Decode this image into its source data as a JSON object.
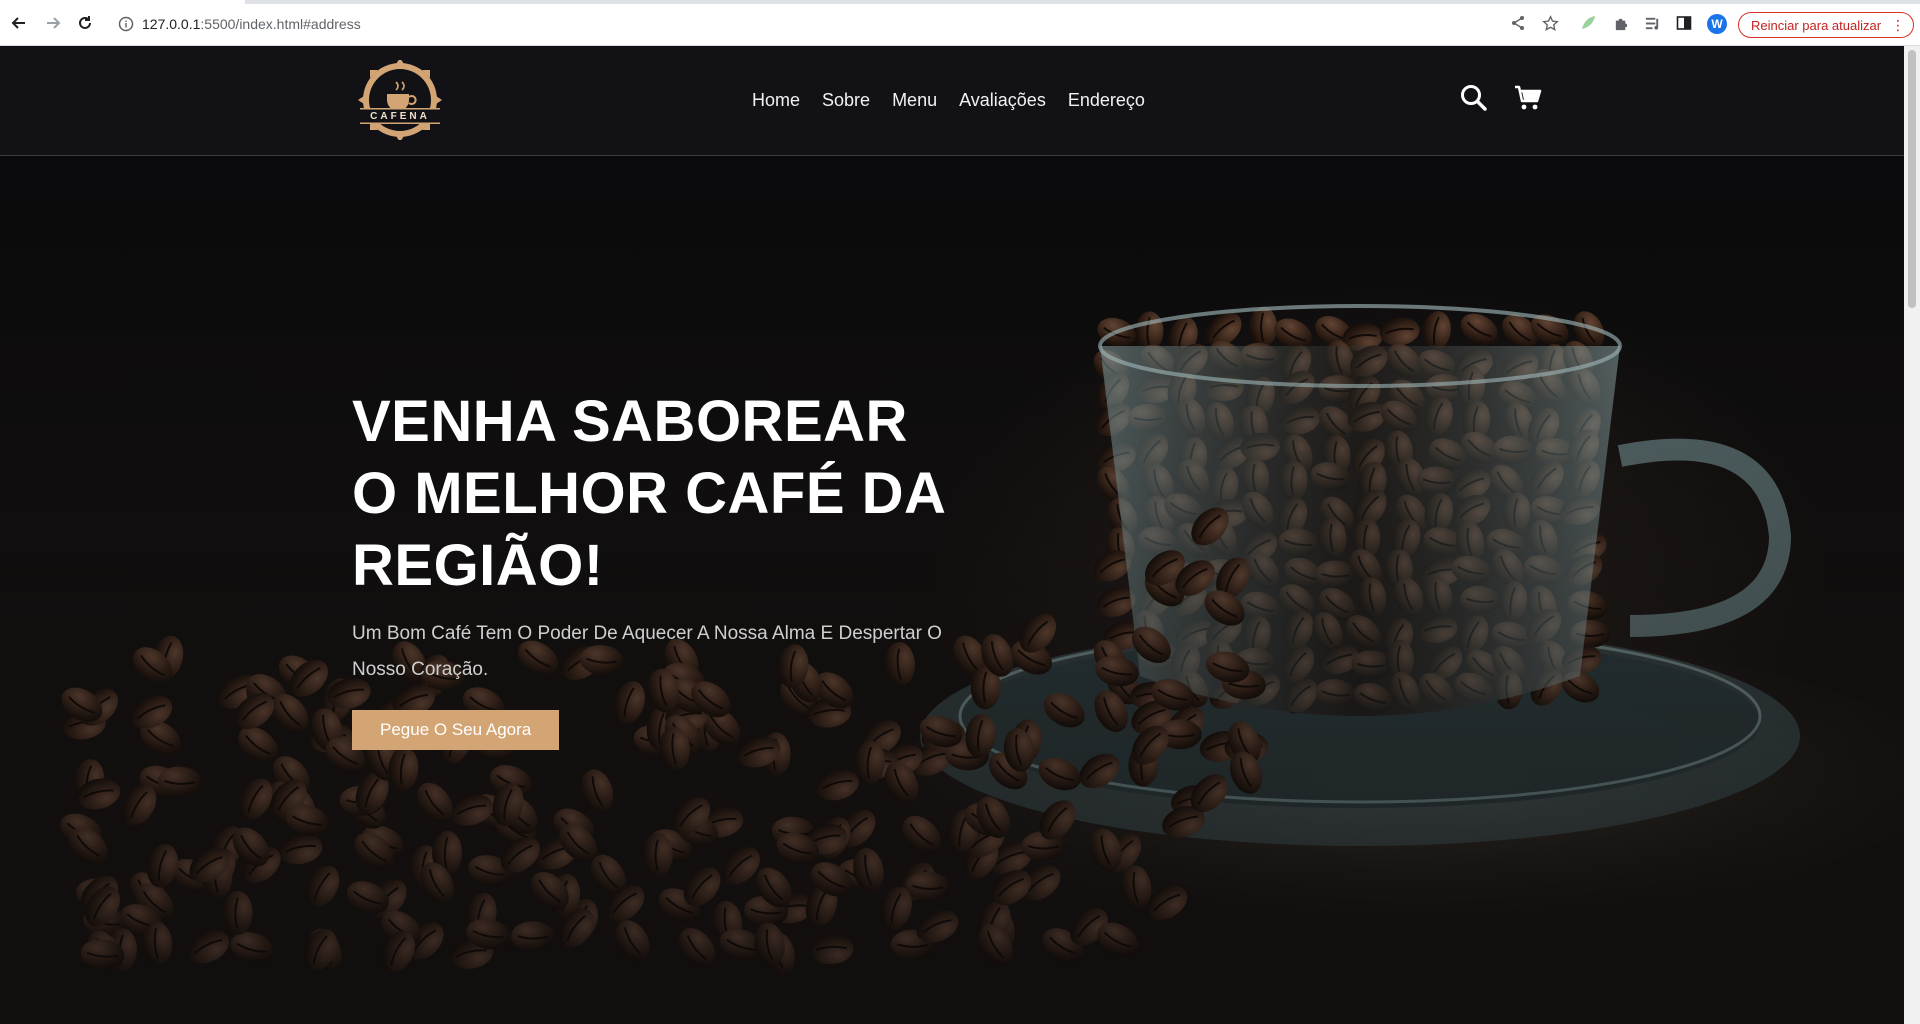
{
  "browser": {
    "url_host": "127.0.0.1",
    "url_rest": ":5500/index.html#address",
    "profile_initial": "W",
    "restart_label": "Reinciar para atualizar"
  },
  "header": {
    "logo_text": "CAFENA",
    "nav": [
      "Home",
      "Sobre",
      "Menu",
      "Avaliações",
      "Endereço"
    ]
  },
  "hero": {
    "title": "VENHA SABOREAR O MELHOR CAFÉ DA REGIÃO!",
    "subtitle": "Um Bom Café Tem O Poder De Aquecer A Nossa Alma E Despertar O Nosso Coração.",
    "cta": "Pegue O Seu Agora"
  },
  "colors": {
    "accent": "#d4a574",
    "header_bg": "#121216",
    "alert": "#d93025"
  },
  "icons": [
    "back-icon",
    "forward-icon",
    "reload-icon",
    "info-icon",
    "share-icon",
    "star-icon",
    "extension-icon",
    "puzzle-icon",
    "media-icon",
    "sidebar-icon",
    "search-icon",
    "cart-icon"
  ]
}
